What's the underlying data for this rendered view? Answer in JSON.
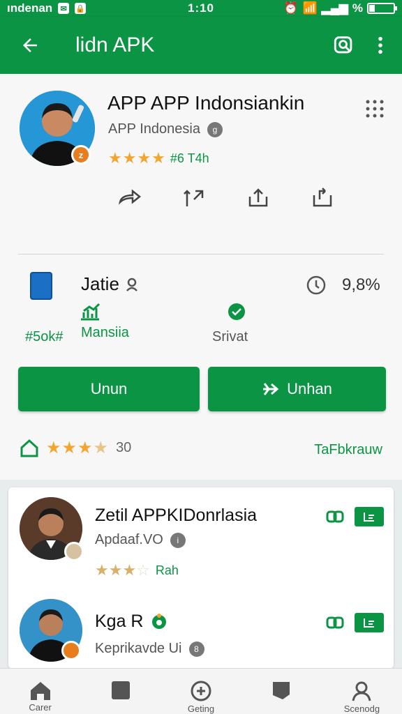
{
  "status_bar": {
    "carrier": "ındenan",
    "time": "1:10",
    "battery_pct": 20
  },
  "app_bar": {
    "title": "lidn APK"
  },
  "app": {
    "title": "APP APP Indonsiankin",
    "developer": "APP Indonesia",
    "rating_text": "#6 T4h",
    "stars": 4,
    "badge": "z"
  },
  "package": {
    "name": "Jatie",
    "version": "9,8%",
    "stats": [
      {
        "value": "#5ok#",
        "label": ""
      },
      {
        "value": "",
        "label": "Mansiia"
      },
      {
        "value": "",
        "label": "Srivat"
      }
    ]
  },
  "buttons": {
    "primary": "Unun",
    "secondary": "Unhan"
  },
  "reviews": {
    "count": "30",
    "stars": 4,
    "link": "TaFbkrauw"
  },
  "similar": [
    {
      "title": "Zetil APPKIDonrlasia",
      "subtitle": "Apdaaf.VO",
      "rating_text": "Rah",
      "stars": 3.5
    },
    {
      "title": "Kga R",
      "subtitle": "Keprikavde Ui",
      "rating_text": "",
      "stars": 0
    }
  ],
  "bottom_nav": [
    {
      "label": "Carer",
      "icon": "home-icon"
    },
    {
      "label": "",
      "icon": "apps-icon"
    },
    {
      "label": "Geting",
      "icon": "games-icon"
    },
    {
      "label": "",
      "icon": "books-icon"
    },
    {
      "label": "Scenodg",
      "icon": "profile-icon"
    }
  ],
  "colors": {
    "accent": "#0b9444",
    "star": "#f2a531",
    "badge": "#e87d1e"
  }
}
